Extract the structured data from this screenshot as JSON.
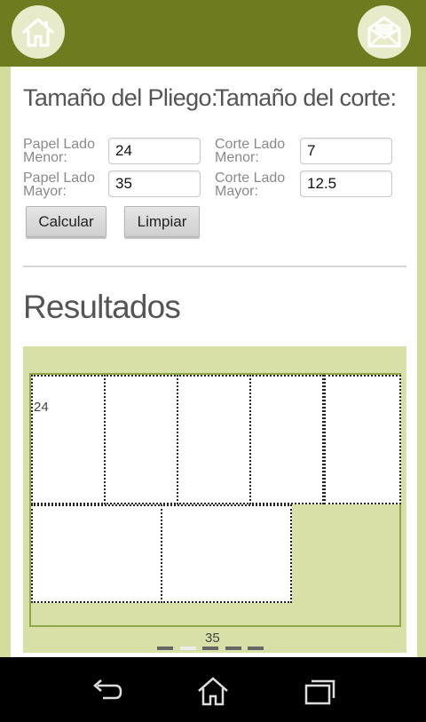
{
  "header": {
    "home_icon": "home-icon",
    "mail_icon": "mail-icon",
    "accent": "#6f7b1f"
  },
  "sheet": {
    "heading": "Tamaño del Pliego:",
    "minor_label": "Papel Lado Menor:",
    "minor_value": "24",
    "major_label": "Papel Lado Mayor:",
    "major_value": "35"
  },
  "cut": {
    "heading": "Tamaño del corte:",
    "minor_label": "Corte Lado Menor:",
    "minor_value": "7",
    "major_label": "Corte Lado Mayor:",
    "major_value": "12.5"
  },
  "buttons": {
    "calculate": "Calcular",
    "clear": "Limpiar"
  },
  "results": {
    "title": "Resultados",
    "side_label": "24",
    "bottom_label": "35",
    "pieces_row1": 5,
    "pieces_row2": 2
  },
  "navbar": {
    "back_icon": "back-icon",
    "home_icon": "home-outline-icon",
    "recents_icon": "recent-apps-icon"
  }
}
